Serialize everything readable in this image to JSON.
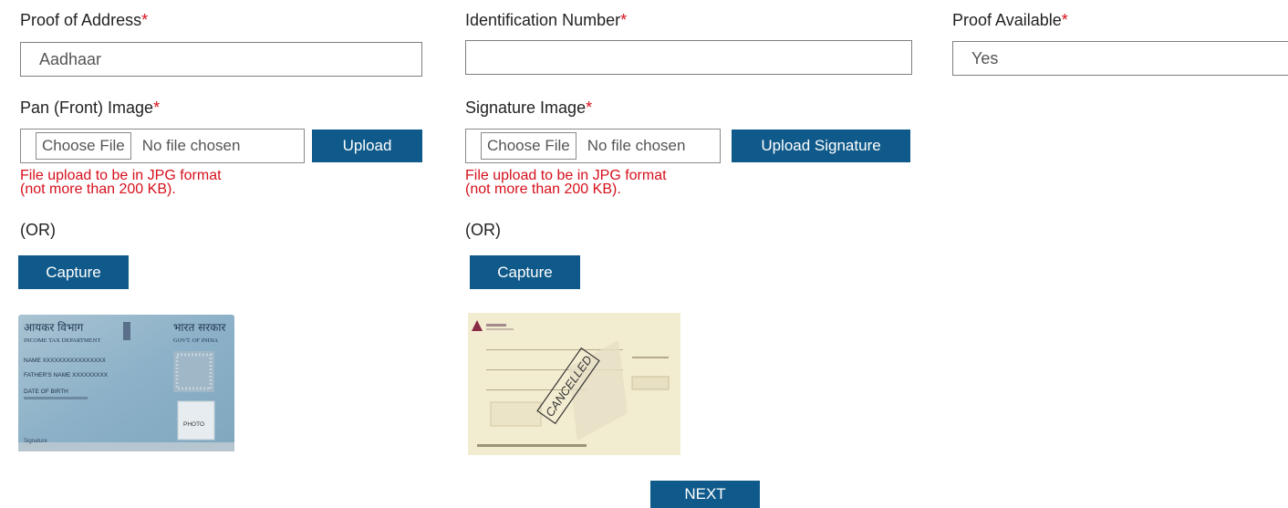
{
  "address": {
    "label": "Proof of Address",
    "asterisk": "*",
    "value": "Aadhaar"
  },
  "identification": {
    "label": "Identification Number",
    "asterisk": "*",
    "value": ""
  },
  "proof_available": {
    "label": "Proof Available",
    "asterisk": "*",
    "value": "Yes"
  },
  "pan": {
    "label": "Pan (Front) Image",
    "asterisk": "*",
    "choose_label": "Choose File",
    "file_status": "No file chosen",
    "upload_label": "Upload",
    "error_line1": "File upload to be in JPG format",
    "error_line2": "(not more than 200 KB).",
    "or_text": "(OR)",
    "capture_label": "Capture",
    "card": {
      "dept_hindi": "आयकर विभाग",
      "govt_hindi": "भारत सरकार",
      "dept_en": "INCOME TAX DEPARTMENT",
      "govt_en": "GOVT. OF INDIA",
      "name_line": "NAME XXXXXXXXXXXXXXXX",
      "father_line": "FATHER'S NAME XXXXXXXXX",
      "dob_line": "DATE OF BIRTH",
      "photo_label": "PHOTO",
      "sign_label": "Signature"
    }
  },
  "signature": {
    "label": "Signature Image",
    "asterisk": "*",
    "choose_label": "Choose File",
    "file_status": "No file chosen",
    "upload_label": "Upload Signature",
    "error_line1": "File upload to be in JPG format",
    "error_line2": "(not more than 200 KB).",
    "or_text": "(OR)",
    "capture_label": "Capture",
    "cheque": {
      "stamp": "CANCELLED"
    }
  },
  "next_label": "NEXT",
  "colors": {
    "button": "#0f5a8a",
    "error": "#d6101c",
    "pan_card": "#8fb3c9",
    "cheque_bg": "#f2ecd0"
  }
}
